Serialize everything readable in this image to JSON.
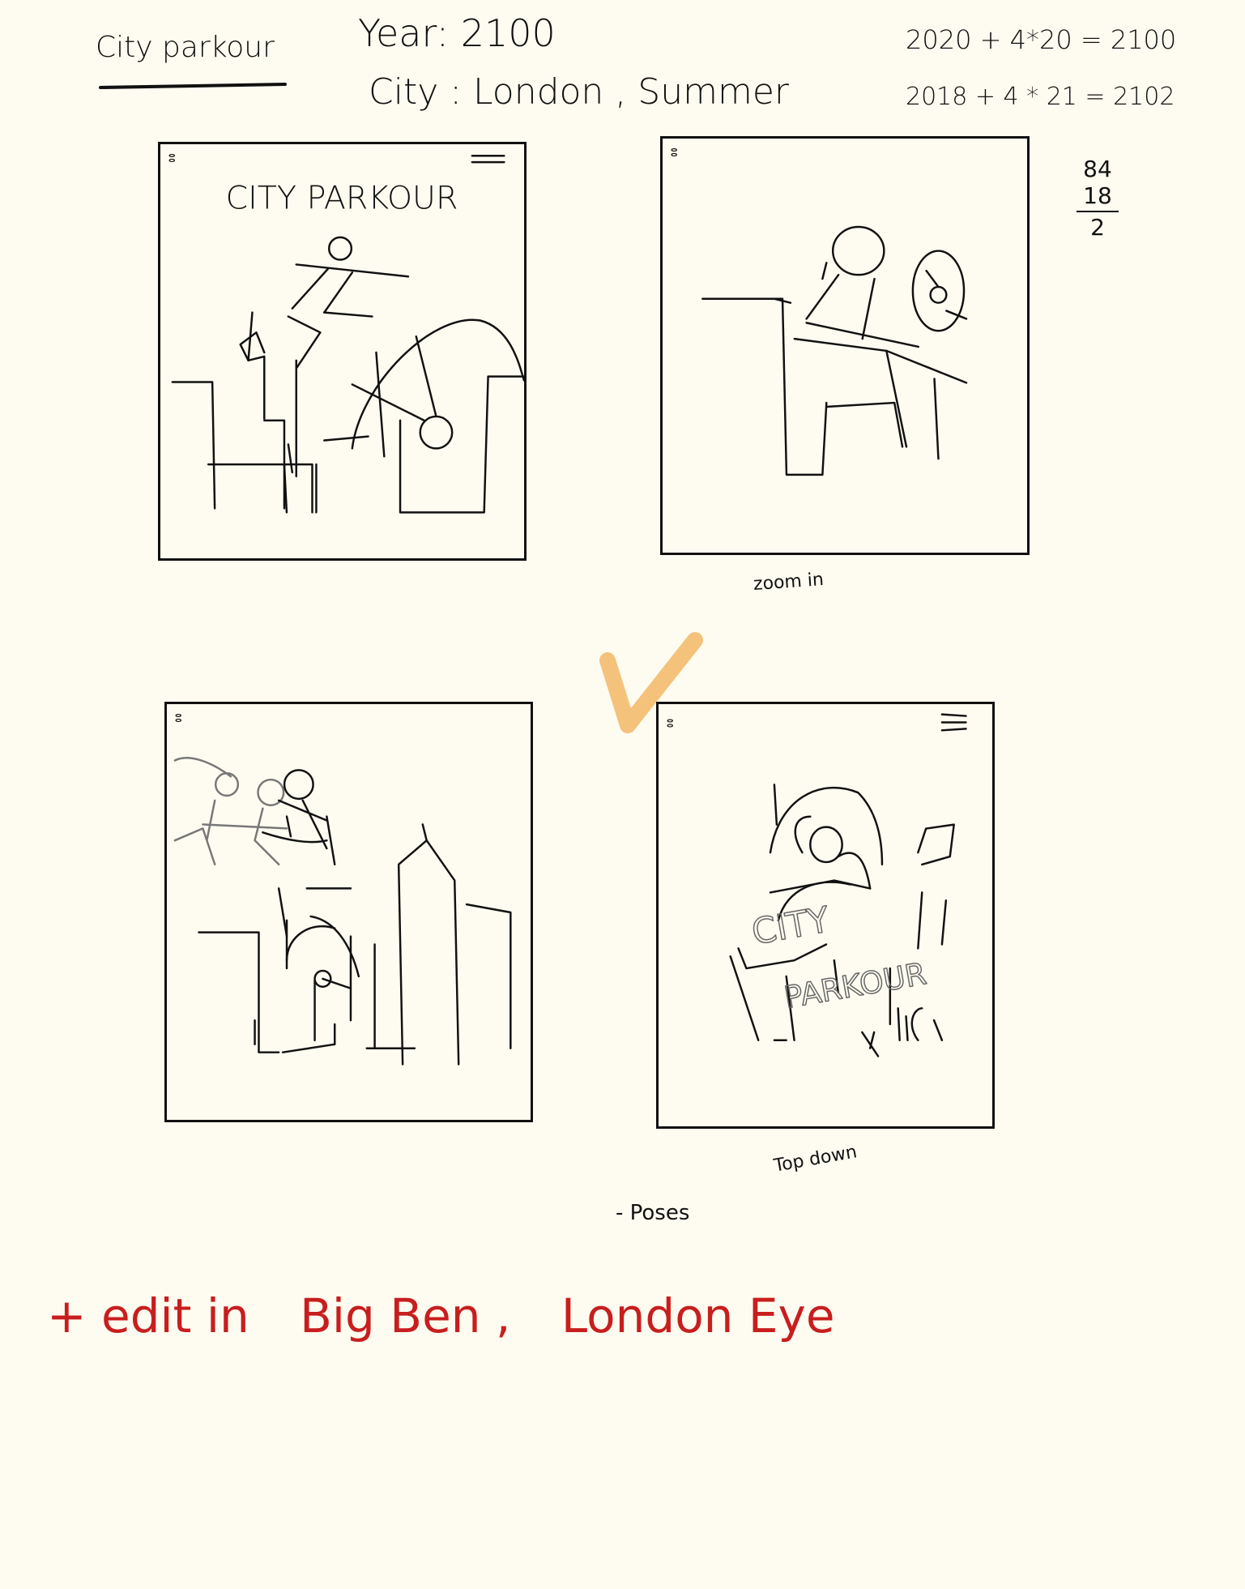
{
  "header": {
    "title": "City parkour",
    "year_line": "Year: 2100",
    "city_line": "City : London , Summer"
  },
  "calculations": {
    "line1": "2020 + 4*20 = 2100",
    "line2": "2018 + 4 * 21 = 2102",
    "fraction_top": "84",
    "fraction_mid": "18",
    "fraction_bottom": "2"
  },
  "panels": {
    "p1_title": "CITY PARKOUR",
    "p4_title_1": "CITY",
    "p4_title_2": "PARKOUR"
  },
  "captions": {
    "zoom": "zoom in",
    "top_down": "Top down",
    "poses": "- Poses"
  },
  "note": {
    "plus": "+ edit in",
    "landmark1": "Big Ben ,",
    "landmark2": "London Eye"
  },
  "colors": {
    "paper": "#fefcf0",
    "ink": "#111111",
    "note_red": "#c81e1e",
    "check_orange": "#f5c27c"
  }
}
